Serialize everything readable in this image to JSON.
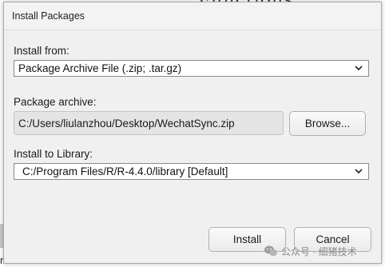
{
  "background": {
    "heading_fragment": "Functions",
    "bottom_fragment": "rt"
  },
  "dialog": {
    "title": "Install Packages",
    "install_from": {
      "label": "Install from:",
      "value": "Package Archive File (.zip; .tar.gz)"
    },
    "package_archive": {
      "label": "Package archive:",
      "value": "C:/Users/liulanzhou/Desktop/WechatSync.zip",
      "browse_label": "Browse..."
    },
    "install_to_library": {
      "label": "Install to Library:",
      "value": "C:/Program Files/R/R-4.4.0/library [Default]"
    },
    "buttons": {
      "install": "Install",
      "cancel": "Cancel"
    }
  },
  "watermark": {
    "text": "公众号 · 细猪技术",
    "icon": "wechat-icon"
  },
  "colors": {
    "dialog_bg": "#f0f0f0",
    "input_disabled_bg": "#e4e4e4",
    "border": "#a8a8a8"
  }
}
